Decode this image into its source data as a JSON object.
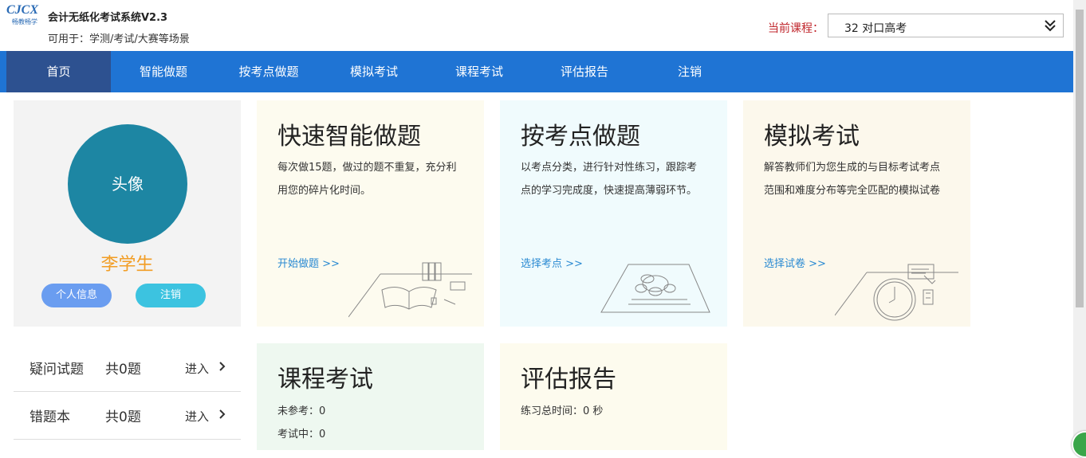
{
  "header": {
    "logo_text": "CJCX",
    "logo_sub": "畅教畅学",
    "title": "会计无纸化考试系统V2.3",
    "subtitle": "可用于：学测/考试/大赛等场景",
    "course_label": "当前课程：",
    "course_value": "32 对口高考"
  },
  "nav": {
    "items": [
      "首页",
      "智能做题",
      "按考点做题",
      "模拟考试",
      "课程考试",
      "评估报告",
      "注销"
    ],
    "active": "首页"
  },
  "profile": {
    "avatar_label": "头像",
    "name": "李学生",
    "info_button": "个人信息",
    "logout_button": "注销"
  },
  "side_list": [
    {
      "label": "疑问试题",
      "count": "共0题",
      "action": "进入"
    },
    {
      "label": "错题本",
      "count": "共0题",
      "action": "进入"
    }
  ],
  "cards": {
    "quick": {
      "title": "快速智能做题",
      "desc": "每次做15题，做过的题不重复，充分利用您的碎片化时间。",
      "link": "开始做题 >>"
    },
    "point": {
      "title": "按考点做题",
      "desc": "以考点分类，进行针对性练习，跟踪考点的学习完成度，快速提高薄弱环节。",
      "link": "选择考点 >>"
    },
    "mock": {
      "title": "模拟考试",
      "desc": "解答教师们为您生成的与目标考试考点范围和难度分布等完全匹配的模拟试卷",
      "link": "选择试卷 >>"
    },
    "course": {
      "title": "课程考试",
      "stat1": "未参考：0",
      "stat2": "考试中：0"
    },
    "report": {
      "title": "评估报告",
      "stat1": "练习总时间：0 秒"
    }
  },
  "colors": {
    "nav_bg": "#1f74d4",
    "nav_active": "#2d5190",
    "accent_name": "#f29d24",
    "link": "#2a8ad2",
    "course_label": "#c0262c"
  }
}
